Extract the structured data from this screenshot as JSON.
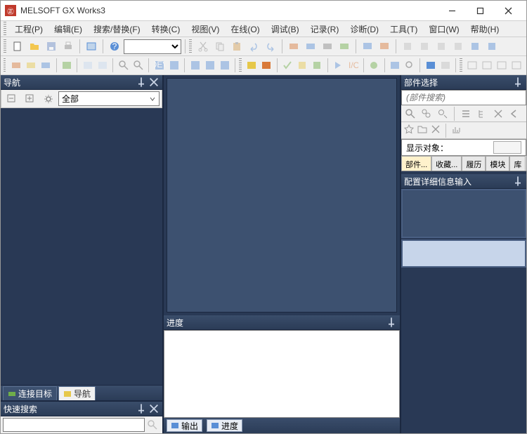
{
  "title": "MELSOFT GX Works3",
  "menu": [
    "工程(P)",
    "编辑(E)",
    "搜索/替换(F)",
    "转换(C)",
    "视图(V)",
    "在线(O)",
    "调试(B)",
    "记录(R)",
    "诊断(D)",
    "工具(T)",
    "窗口(W)",
    "帮助(H)"
  ],
  "nav": {
    "title": "导航",
    "filter_label": "全部",
    "tabs": [
      {
        "label": "连接目标"
      },
      {
        "label": "导航"
      }
    ]
  },
  "quick_search": {
    "title": "快速搜索",
    "value": ""
  },
  "center": {
    "progress_title": "进度"
  },
  "bottom_tabs": [
    "输出",
    "进度"
  ],
  "parts": {
    "title": "部件选择",
    "search_placeholder": "(部件搜索)",
    "display_target_label": "显示对象：",
    "tabs": [
      "部件...",
      "收藏...",
      "履历",
      "模块",
      "库"
    ]
  },
  "config": {
    "title": "配置详细信息输入"
  }
}
